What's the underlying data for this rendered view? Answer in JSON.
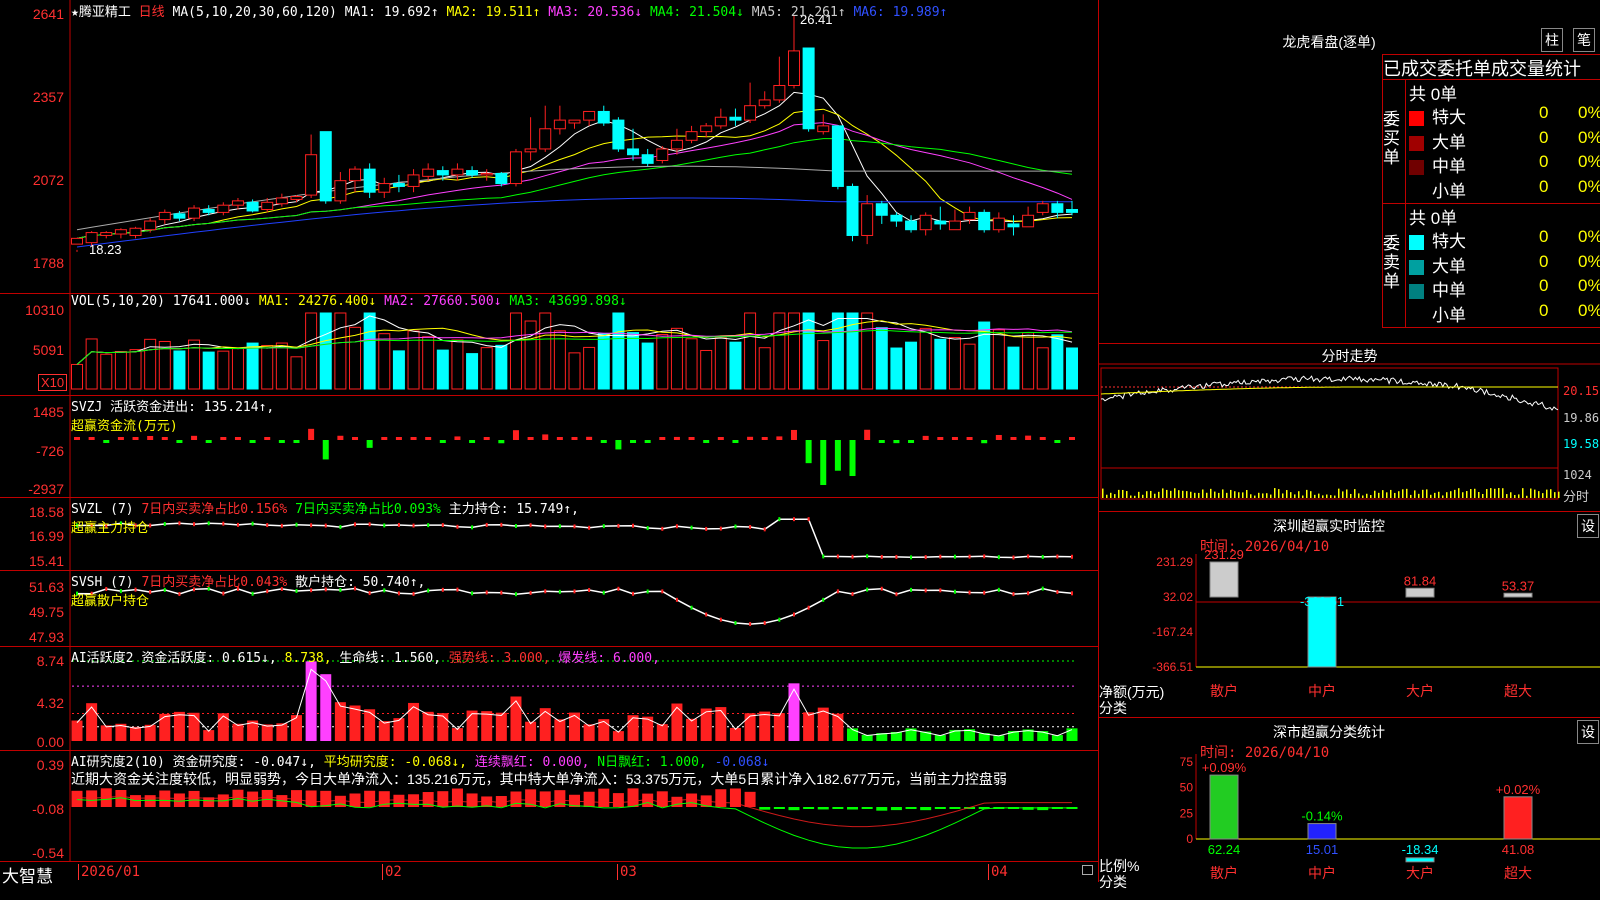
{
  "app": {
    "brand": "大智慧",
    "stock_name": "★腾亚精工",
    "period": "日线"
  },
  "colors": {
    "up": "#ff2020",
    "down": "#00ffff",
    "ma1": "#ffffff",
    "ma2": "#ffff00",
    "ma3": "#ff40ff",
    "ma4": "#00ff00",
    "ma5": "#aaaaaa",
    "ma6": "#2040ff"
  },
  "kline": {
    "header": {
      "ma_label": "MA(5,10,20,30,60,120)",
      "ma1": "MA1: 19.692↑",
      "ma2": "MA2: 19.511↑",
      "ma3": "MA3: 20.536↓",
      "ma4": "MA4: 21.504↓",
      "ma5": "MA5: 21.261↑",
      "ma6": "MA6: 19.989↑"
    },
    "yticks": [
      "2641",
      "2357",
      "2072",
      "1788"
    ],
    "high_label": "26.41",
    "low_label": "18.23"
  },
  "vol": {
    "header": {
      "label": "VOL(5,10,20)",
      "value": "17641.000↓",
      "ma1": "MA1: 24276.400↓",
      "ma2": "MA2: 27660.500↓",
      "ma3": "MA3: 43699.898↓"
    },
    "yticks": [
      "10310",
      "5091"
    ],
    "unit": "X10"
  },
  "svzj": {
    "header": {
      "label": "SVZJ",
      "value": "活跃资金进出: 135.214↑,",
      "sub": "超赢资金流(万元)"
    },
    "yticks": [
      "1485",
      "-726",
      "-2937"
    ]
  },
  "svzl": {
    "header": {
      "label": "SVZL (7)",
      "a": "7日内买卖净占比0.156%",
      "b": "7日内买卖净占比0.093%",
      "c": "主力持仓: 15.749↑,",
      "sub": "超赢主力持仓"
    },
    "yticks": [
      "18.58",
      "16.99",
      "15.41"
    ]
  },
  "svsh": {
    "header": {
      "label": "SVSH (7)",
      "a": "7日内买卖净占比0.043%",
      "c": "散户持仓: 50.740↑,",
      "sub": "超赢散户持仓"
    },
    "yticks": [
      "51.63",
      "49.75",
      "47.93"
    ]
  },
  "ai1": {
    "header": {
      "label": "AI活跃度2",
      "a": "资金活跃度: 0.615↓,",
      "b": "8.738,",
      "c": "生命线: 1.560,",
      "d": "强势线: 3.000,",
      "e": "爆发线: 6.000,"
    },
    "yticks": [
      "8.74",
      "4.32",
      "0.00"
    ]
  },
  "ai2": {
    "header": {
      "label": "AI研究度2(10)",
      "a": "资金研究度: -0.047↓,",
      "b": "平均研究度: -0.068↓,",
      "c": "连续飘红: 0.000,",
      "d": "N日飘红: 1.000,",
      "e": "-0.068↓"
    },
    "comment": "近期大资金关注度较低，明显弱势，今日大单净流入：135.216万元，其中特大单净流入：53.375万元，大单5日累计净入182.677万元，当前主力控盘弱",
    "yticks": [
      "0.39",
      "-0.08",
      "-0.54"
    ]
  },
  "xaxis": {
    "labels": [
      "2026/01",
      "02",
      "03",
      "04"
    ]
  },
  "dragon": {
    "title": "龙虎看盘(逐单)",
    "btn_bar": "柱",
    "btn_pen": "笔",
    "subtitle": "已成交委托单成交量统计",
    "buy": {
      "side": "委买单",
      "total": "共 0单",
      "rows": [
        {
          "label": "特大",
          "count": "0",
          "pct": "0%",
          "color": "#ff0000"
        },
        {
          "label": "大单",
          "count": "0",
          "pct": "0%",
          "color": "#a00000"
        },
        {
          "label": "中单",
          "count": "0",
          "pct": "0%",
          "color": "#700000"
        },
        {
          "label": "小单",
          "count": "0",
          "pct": "0%",
          "color": "#000000"
        }
      ]
    },
    "sell": {
      "side": "委卖单",
      "total": "共 0单",
      "rows": [
        {
          "label": "特大",
          "count": "0",
          "pct": "0%",
          "color": "#00ffff"
        },
        {
          "label": "大单",
          "count": "0",
          "pct": "0%",
          "color": "#00a0a0"
        },
        {
          "label": "中单",
          "count": "0",
          "pct": "0%",
          "color": "#008080"
        },
        {
          "label": "小单",
          "count": "0",
          "pct": "0%",
          "color": "#000000"
        }
      ]
    }
  },
  "intraday": {
    "title": "分时走势",
    "yticks": [
      "20.15",
      "19.86",
      "19.58",
      "1024"
    ],
    "xlabel": "分时"
  },
  "monitor": {
    "title": "深圳超赢实时监控",
    "btn": "设",
    "time": "时间: 2026/04/10",
    "yticks": [
      "231.29",
      "32.02",
      "-167.24",
      "-366.51"
    ],
    "ylabel": "净额(万元)",
    "xlabel": "分类"
  },
  "classify": {
    "title": "深市超赢分类统计",
    "btn": "设",
    "time": "时间: 2026/04/10",
    "yticks": [
      "75",
      "50",
      "25",
      "0"
    ],
    "ylabel": "比例%",
    "xlabel": "分类"
  },
  "chart_data": [
    {
      "type": "bar",
      "title": "深圳超赢实时监控",
      "categories": [
        "散户",
        "中户",
        "大户",
        "超大"
      ],
      "values": [
        231.29,
        -366.51,
        81.84,
        53.37
      ],
      "ylabel": "净额(万元)",
      "ylim": [
        -366.51,
        231.29
      ]
    },
    {
      "type": "bar",
      "title": "深市超赢分类统计",
      "categories": [
        "散户",
        "中户",
        "大户",
        "超大"
      ],
      "values": [
        62.24,
        15.01,
        -18.34,
        41.08
      ],
      "pct_labels": [
        "+0.09%",
        "-0.14%",
        "",
        "+0.02%"
      ],
      "ylabel": "比例%",
      "ylim": [
        0,
        75
      ]
    },
    {
      "type": "candlestick",
      "title": "腾亚精工 日线",
      "ylim": [
        17.88,
        26.41
      ],
      "ohlc": [
        [
          18.5,
          18.7,
          18.3,
          18.23
        ],
        [
          18.55,
          18.9,
          18.45,
          18.95
        ],
        [
          18.8,
          18.9,
          18.7,
          18.95
        ],
        [
          18.85,
          19.0,
          18.7,
          19.05
        ],
        [
          18.8,
          19.05,
          18.7,
          19.1
        ],
        [
          19.0,
          19.3,
          18.9,
          19.4
        ],
        [
          19.35,
          19.6,
          19.2,
          19.7
        ],
        [
          19.55,
          19.4,
          19.3,
          19.65
        ],
        [
          19.4,
          19.75,
          19.3,
          19.85
        ],
        [
          19.7,
          19.6,
          19.5,
          19.85
        ],
        [
          19.6,
          19.85,
          19.5,
          19.95
        ],
        [
          19.85,
          20.0,
          19.7,
          20.1
        ],
        [
          19.95,
          19.65,
          19.6,
          20.05
        ],
        [
          19.7,
          19.95,
          19.6,
          20.1
        ],
        [
          19.9,
          20.1,
          19.8,
          20.25
        ],
        [
          20.05,
          20.15,
          19.95,
          20.2
        ],
        [
          20.2,
          21.6,
          20.1,
          22.3
        ],
        [
          22.4,
          20.0,
          19.9,
          22.4
        ],
        [
          20.0,
          20.7,
          19.9,
          21.0
        ],
        [
          20.7,
          21.1,
          20.3,
          21.2
        ],
        [
          21.1,
          20.3,
          20.1,
          21.3
        ],
        [
          20.3,
          20.6,
          20.1,
          20.8
        ],
        [
          20.6,
          20.5,
          20.3,
          20.9
        ],
        [
          20.5,
          20.9,
          20.3,
          21.1
        ],
        [
          20.85,
          21.1,
          20.7,
          21.3
        ],
        [
          21.05,
          20.9,
          20.7,
          21.2
        ],
        [
          20.9,
          21.1,
          20.7,
          21.3
        ],
        [
          21.05,
          20.9,
          20.8,
          21.2
        ],
        [
          20.9,
          20.95,
          20.7,
          21.1
        ],
        [
          20.95,
          20.6,
          20.5,
          21.0
        ],
        [
          20.6,
          21.7,
          20.5,
          21.8
        ],
        [
          21.7,
          21.8,
          21.4,
          22.9
        ],
        [
          21.8,
          22.5,
          21.7,
          23.3
        ],
        [
          22.5,
          22.8,
          22.3,
          23.3
        ],
        [
          22.7,
          22.8,
          22.5,
          22.8
        ],
        [
          22.8,
          23.1,
          22.6,
          23.1
        ],
        [
          23.1,
          22.7,
          22.6,
          23.3
        ],
        [
          22.8,
          21.8,
          21.7,
          22.9
        ],
        [
          21.8,
          21.6,
          21.4,
          22.5
        ],
        [
          21.6,
          21.3,
          21.2,
          21.8
        ],
        [
          21.4,
          21.8,
          21.3,
          21.9
        ],
        [
          21.8,
          22.1,
          21.6,
          22.5
        ],
        [
          22.1,
          22.4,
          22.0,
          22.6
        ],
        [
          22.4,
          22.6,
          22.2,
          22.7
        ],
        [
          22.6,
          22.9,
          22.5,
          23.2
        ],
        [
          22.9,
          22.8,
          22.6,
          23.2
        ],
        [
          22.8,
          23.3,
          22.7,
          24.1
        ],
        [
          23.3,
          23.5,
          23.2,
          23.8
        ],
        [
          23.5,
          24.0,
          23.4,
          25.0
        ],
        [
          24.0,
          25.2,
          23.9,
          26.41
        ],
        [
          25.3,
          22.5,
          22.4,
          25.3
        ],
        [
          22.4,
          22.6,
          22.3,
          23.0
        ],
        [
          22.6,
          20.5,
          20.4,
          22.6
        ],
        [
          20.5,
          18.8,
          18.6,
          20.6
        ],
        [
          18.8,
          19.9,
          18.5,
          20.2
        ],
        [
          19.9,
          19.5,
          19.2,
          20.0
        ],
        [
          19.5,
          19.3,
          19.1,
          19.6
        ],
        [
          19.3,
          19.0,
          18.9,
          19.5
        ],
        [
          19.0,
          19.5,
          18.8,
          19.6
        ],
        [
          19.3,
          19.2,
          19.0,
          19.8
        ],
        [
          19.0,
          19.3,
          19.0,
          19.7
        ],
        [
          19.35,
          19.6,
          19.2,
          19.8
        ],
        [
          19.6,
          19.0,
          18.9,
          19.7
        ],
        [
          19.0,
          19.4,
          18.9,
          19.6
        ],
        [
          19.2,
          19.1,
          18.8,
          19.5
        ],
        [
          19.1,
          19.5,
          19.1,
          19.8
        ],
        [
          19.6,
          19.9,
          19.5,
          20.0
        ],
        [
          19.9,
          19.6,
          19.4,
          20.0
        ],
        [
          19.7,
          19.6,
          19.5,
          20.0
        ]
      ]
    }
  ]
}
